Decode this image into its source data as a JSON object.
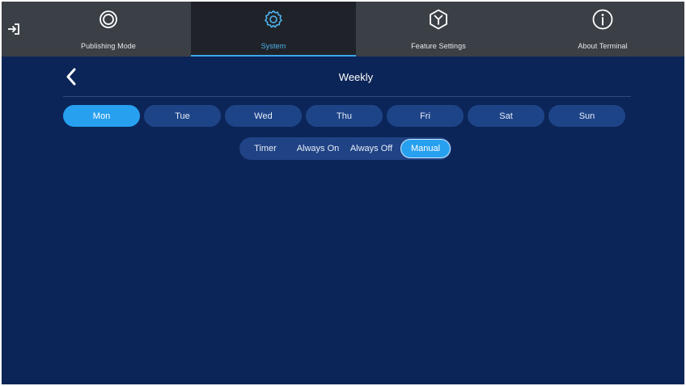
{
  "nav": {
    "exit_icon": "exit-icon",
    "tabs": [
      {
        "label": "Publishing Mode",
        "icon": "publishing-icon",
        "active": false
      },
      {
        "label": "System",
        "icon": "gear-icon",
        "active": true
      },
      {
        "label": "Feature Settings",
        "icon": "feature-icon",
        "active": false
      },
      {
        "label": "About Terminal",
        "icon": "info-icon",
        "active": false
      }
    ]
  },
  "page": {
    "title": "Weekly",
    "back_icon": "chevron-left-icon"
  },
  "days": [
    {
      "label": "Mon",
      "selected": true
    },
    {
      "label": "Tue",
      "selected": false
    },
    {
      "label": "Wed",
      "selected": false
    },
    {
      "label": "Thu",
      "selected": false
    },
    {
      "label": "Fri",
      "selected": false
    },
    {
      "label": "Sat",
      "selected": false
    },
    {
      "label": "Sun",
      "selected": false
    }
  ],
  "modes": [
    {
      "label": "Timer",
      "selected": false
    },
    {
      "label": "Always On",
      "selected": false
    },
    {
      "label": "Always Off",
      "selected": false
    },
    {
      "label": "Manual",
      "selected": true
    }
  ],
  "colors": {
    "background": "#0c2558",
    "topbar": "#3b3f46",
    "active_tab": "#1f2329",
    "accent": "#27a0f0",
    "pill": "#1e4488"
  }
}
